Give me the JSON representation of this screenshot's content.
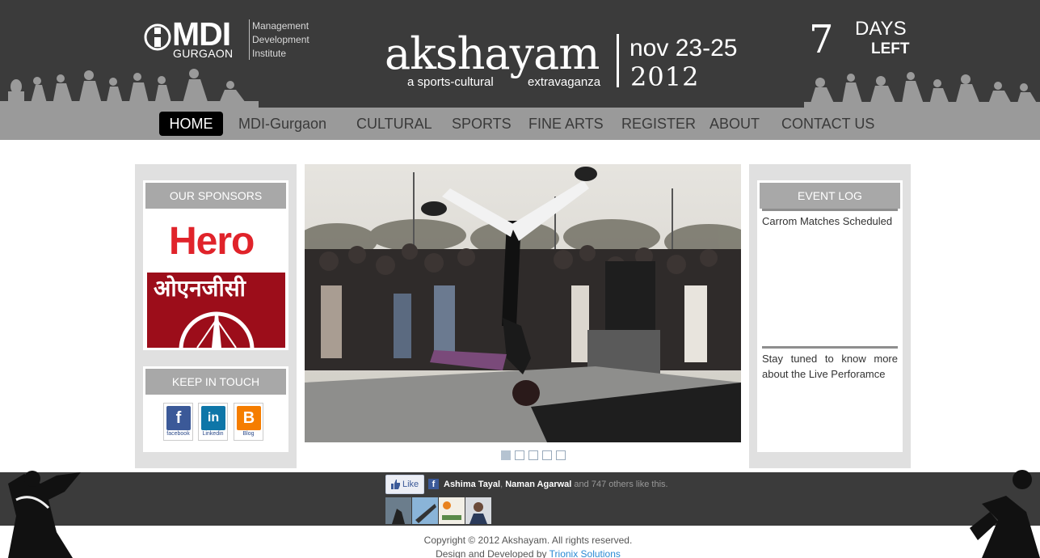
{
  "header": {
    "logo": {
      "name": "MDI",
      "sub": "GURGAON",
      "lines": [
        "Management",
        "Development",
        "Institute"
      ]
    },
    "event": {
      "title": "akshayam",
      "tagline_a": "a sports-cultural",
      "tagline_b": "extravaganza",
      "dates": "nov 23-25",
      "year": "2012"
    },
    "countdown": {
      "number": "7",
      "word": "DAYS",
      "suffix": "LEFT"
    }
  },
  "nav": {
    "items": [
      "HOME",
      "MDI-Gurgaon",
      "CULTURAL",
      "SPORTS",
      "FINE ARTS",
      "REGISTER",
      "ABOUT",
      "CONTACT US"
    ],
    "active": "HOME"
  },
  "sidebar_left": {
    "sponsors_title": "OUR SPONSORS",
    "sponsors": [
      {
        "name": "Hero",
        "text": "Hero",
        "color": "#e0232a"
      },
      {
        "name": "ONGC",
        "text": "ओएनजीसी",
        "color": "#9c0d1a"
      }
    ],
    "touch_title": "KEEP IN TOUCH",
    "social": [
      {
        "label": "f",
        "caption": "facebook",
        "color": "#3b5998"
      },
      {
        "label": "in",
        "caption": "Linkedin",
        "color": "#0e76a8"
      },
      {
        "label": "B",
        "caption": "Blog",
        "color": "#f57d00"
      }
    ]
  },
  "slider": {
    "pages": 5,
    "active": 1
  },
  "sidebar_right": {
    "title": "EVENT LOG",
    "entries": [
      "Carrom Matches Scheduled",
      "Stay tuned to know more about the Live Perforamce"
    ]
  },
  "footer": {
    "like_label": "Like",
    "friend_a": "Ashima Tayal",
    "friend_b": "Naman Agarwal",
    "likes_rest": "and 747 others like this.",
    "copyright": "Copyright © 2012 Akshayam. All rights reserved.",
    "credit_prefix": "Design and Developed by",
    "credit_link": "Trionix Solutions"
  }
}
